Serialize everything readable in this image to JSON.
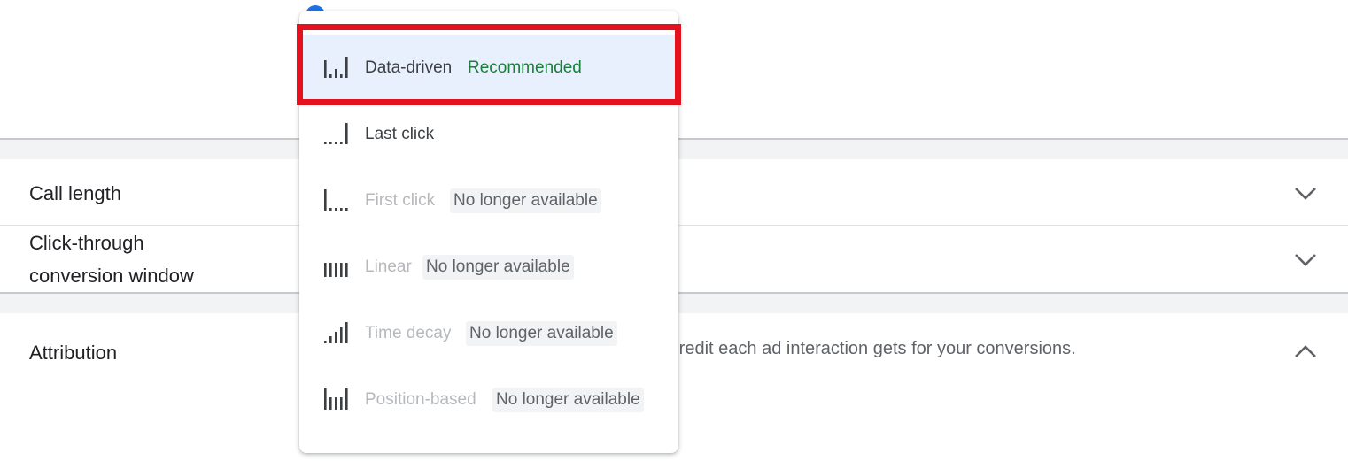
{
  "settings": {
    "rows": [
      {
        "label_line1": "Call length",
        "label_line2": "",
        "chevron": "chevron-down-icon"
      },
      {
        "label_line1": "Click-through",
        "label_line2": "conversion window",
        "chevron": "chevron-down-icon"
      },
      {
        "label_line1": "Attribution",
        "label_line2": "",
        "chevron": "chevron-up-icon"
      }
    ],
    "attribution_description": "h credit each ad interaction gets for your conversions."
  },
  "menu": {
    "options": [
      {
        "label": "Data-driven",
        "badge": "Recommended",
        "icon": "data-driven-icon",
        "state": "selected"
      },
      {
        "label": "Last click",
        "badge": "",
        "icon": "last-click-icon",
        "state": "enabled"
      },
      {
        "label": "First click",
        "badge": "No longer available",
        "icon": "first-click-icon",
        "state": "disabled"
      },
      {
        "label": "Linear",
        "badge": "No longer available",
        "icon": "linear-icon",
        "state": "disabled"
      },
      {
        "label": "Time decay",
        "badge": "No longer available",
        "icon": "time-decay-icon",
        "state": "disabled"
      },
      {
        "label": "Position-based",
        "badge": "No longer available",
        "icon": "position-based-icon",
        "state": "disabled"
      }
    ]
  },
  "colors": {
    "selected_bg": "#e8f0fe",
    "recommended_green": "#188038",
    "highlight_red": "#e3121e",
    "disabled_text": "#b5b8bc"
  }
}
